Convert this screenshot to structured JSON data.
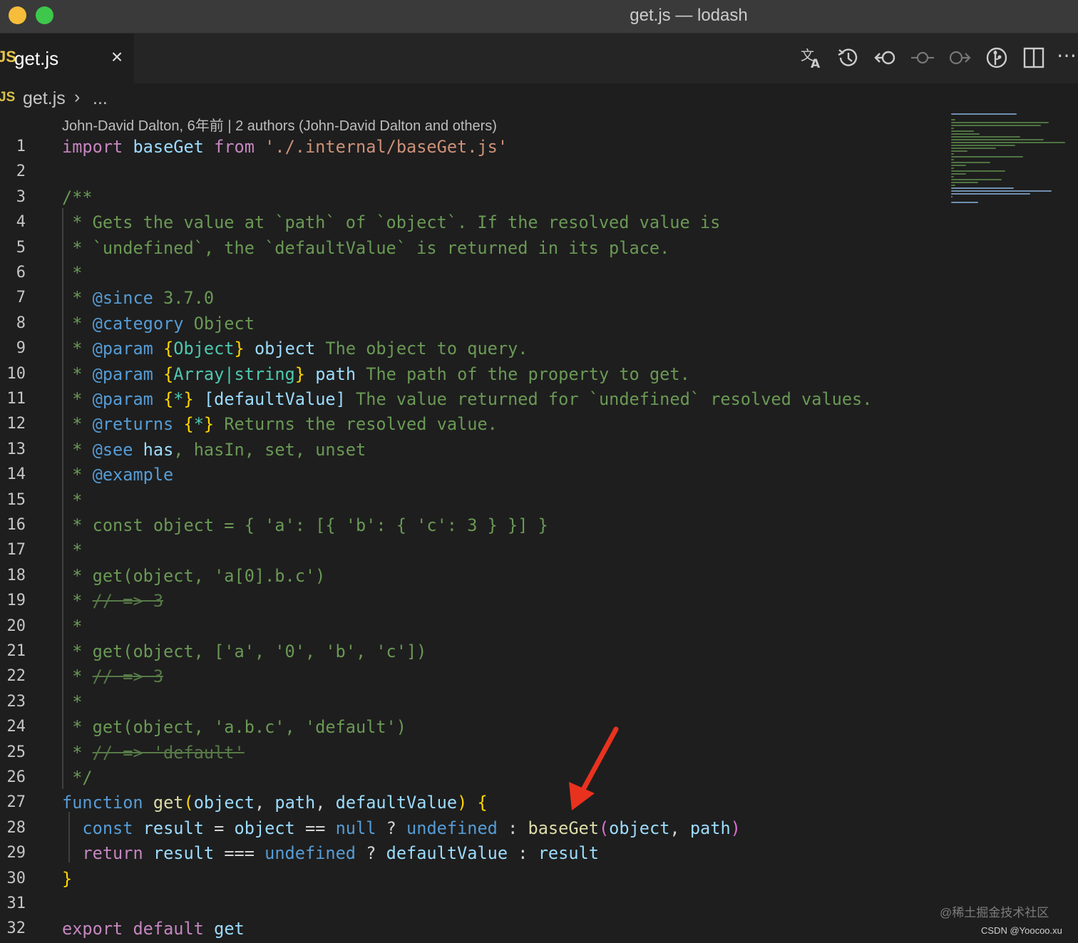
{
  "window": {
    "title": "get.js — lodash"
  },
  "tab": {
    "lang_badge": "JS",
    "label": "get.js",
    "close_glyph": "×"
  },
  "toolbar": {
    "actions": [
      "translate-icon",
      "history-icon",
      "go-back-icon",
      "commit-icon",
      "go-forward-icon",
      "git-compare-icon",
      "split-editor-icon",
      "more-actions-icon"
    ],
    "more_glyph": "⋯"
  },
  "breadcrumb": {
    "lang_badge": "JS",
    "file": "get.js",
    "separator": "›",
    "more": "..."
  },
  "blame": {
    "text": "John-David Dalton, 6年前 | 2 authors (John-David Dalton and others)"
  },
  "editor": {
    "line_numbers": [
      "1",
      "2",
      "3",
      "4",
      "5",
      "6",
      "7",
      "8",
      "9",
      "10",
      "11",
      "12",
      "13",
      "14",
      "15",
      "16",
      "17",
      "18",
      "19",
      "20",
      "21",
      "22",
      "23",
      "24",
      "25",
      "26",
      "27",
      "28",
      "29",
      "30",
      "31",
      "32"
    ],
    "tokens": {
      "l1": [
        "import",
        " ",
        "baseGet",
        " ",
        "from",
        " ",
        "'./.internal/baseGet.js'"
      ],
      "l3": [
        "/**"
      ],
      "l4": [
        " * ",
        "Gets the value at `path` of `object`. If the resolved value is"
      ],
      "l5": [
        " * ",
        "`undefined`, the `defaultValue` is returned in its place."
      ],
      "l6": [
        " *"
      ],
      "l7": [
        " * ",
        "@since",
        " 3.7.0"
      ],
      "l8": [
        " * ",
        "@category",
        " Object"
      ],
      "l9": [
        " * ",
        "@param",
        " ",
        "{",
        "Object",
        "}",
        " ",
        "object",
        " The object to query."
      ],
      "l10": [
        " * ",
        "@param",
        " ",
        "{",
        "Array|string",
        "}",
        " ",
        "path",
        " The path of the property to get."
      ],
      "l11": [
        " * ",
        "@param",
        " ",
        "{",
        "*",
        "}",
        " ",
        "[defaultValue]",
        " The value returned for `undefined` resolved values."
      ],
      "l12": [
        " * ",
        "@returns",
        " ",
        "{",
        "*",
        "}",
        " Returns the resolved value."
      ],
      "l13": [
        " * ",
        "@see",
        " ",
        "has",
        ", hasIn, set, unset"
      ],
      "l14": [
        " * ",
        "@example"
      ],
      "l15": [
        " *"
      ],
      "l16": [
        " * ",
        "const object = { 'a': [{ 'b': { 'c': 3 } }] }"
      ],
      "l17": [
        " *"
      ],
      "l18": [
        " * ",
        "get(object, 'a[0].b.c')"
      ],
      "l19": [
        " * ",
        "// => 3"
      ],
      "l20": [
        " *"
      ],
      "l21": [
        " * ",
        "get(object, ['a', '0', 'b', 'c'])"
      ],
      "l22": [
        " * ",
        "// => 3"
      ],
      "l23": [
        " *"
      ],
      "l24": [
        " * ",
        "get(object, 'a.b.c', 'default')"
      ],
      "l25": [
        " * ",
        "// => 'default'"
      ],
      "l26": [
        " */"
      ],
      "l27": [
        "function",
        " ",
        "get",
        "(",
        "object",
        ", ",
        "path",
        ", ",
        "defaultValue",
        ")",
        " ",
        "{"
      ],
      "l28": [
        "  ",
        "const",
        " ",
        "result",
        " = ",
        "object",
        " == ",
        "null",
        " ? ",
        "undefined",
        " : ",
        "baseGet",
        "(",
        "object",
        ", ",
        "path",
        ")"
      ],
      "l29": [
        "  ",
        "return",
        " ",
        "result",
        " === ",
        "undefined",
        " ? ",
        "defaultValue",
        " : ",
        "result"
      ],
      "l30": [
        "}"
      ],
      "l32": [
        "export",
        " ",
        "default",
        " ",
        "get"
      ]
    }
  },
  "watermark": {
    "line1": "@稀土掘金技术社区",
    "line2": "CSDN @Yoocoo.xu"
  },
  "colors": {
    "background": "#1e1e1e",
    "titlebar": "#3a3a3a",
    "comment": "#6a9955",
    "jsdoc_tag": "#569cd6",
    "keyword": "#c586c0",
    "string": "#ce9178",
    "variable": "#9cdcfe",
    "annotation_arrow": "#e8321e"
  }
}
